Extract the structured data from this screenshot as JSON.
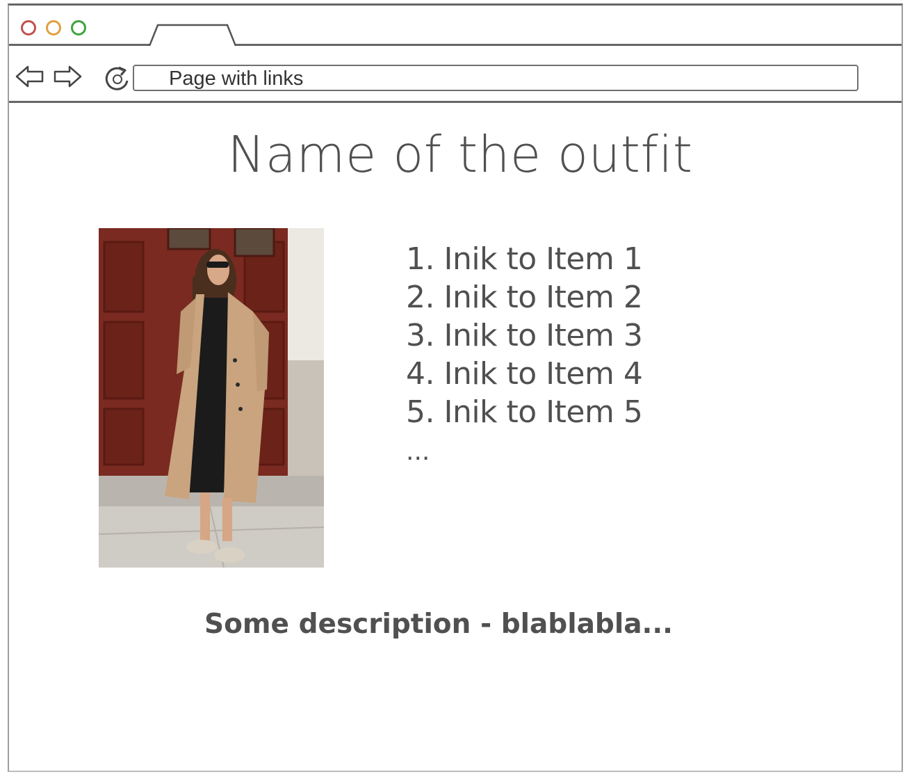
{
  "browser": {
    "url_text": "Page with links"
  },
  "main": {
    "title": "Name of the outfit",
    "links": [
      {
        "label": "1. Inik to Item 1"
      },
      {
        "label": "2. Inik to Item 2"
      },
      {
        "label": "3. Inik to Item 3"
      },
      {
        "label": "4. Inik to Item 4"
      },
      {
        "label": "5. Inik to Item 5"
      }
    ],
    "more": "...",
    "description": "Some description - blablabla..."
  },
  "colors": {
    "frame": "#666666",
    "text": "#505050",
    "close_button": "#c0504d",
    "minimize_button": "#e0a040",
    "maximize_button": "#3ca53c"
  }
}
